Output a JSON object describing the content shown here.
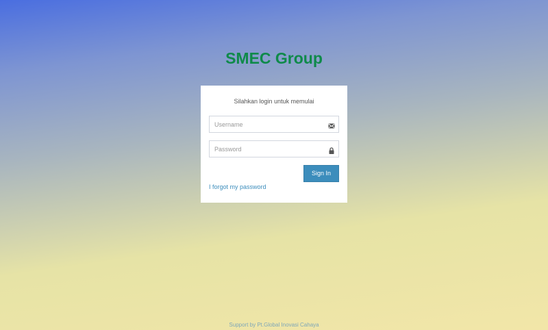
{
  "brand": {
    "title": "SMEC Group"
  },
  "login": {
    "message": "Silahkan login untuk memulai",
    "username": {
      "placeholder": "Username",
      "value": "",
      "icon": "envelope-icon"
    },
    "password": {
      "placeholder": "Password",
      "value": "",
      "icon": "lock-icon"
    },
    "signin_label": "Sign In",
    "forgot_label": "I forgot my password"
  },
  "footer": {
    "text": "Support by Pt.Global Inovasi Cahaya"
  },
  "colors": {
    "brand": "#0f8a4a",
    "primary_button": "#3c8dbc",
    "link": "#3c8dbc",
    "background_top": "#4a6ee0",
    "background_bottom": "#f2e6a8"
  }
}
